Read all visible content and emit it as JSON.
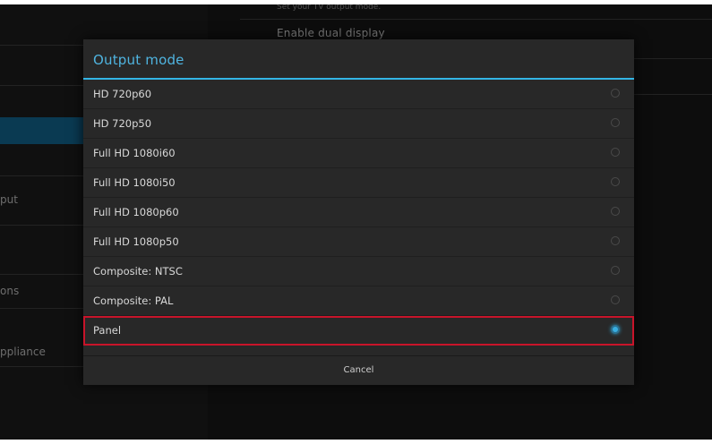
{
  "background": {
    "left_items": [
      {
        "label": ""
      },
      {
        "label": ""
      },
      {
        "label": ""
      },
      {
        "label": ""
      },
      {
        "label": "put"
      },
      {
        "label": ""
      },
      {
        "label": "ons"
      },
      {
        "label": "ppliance"
      }
    ],
    "right": {
      "summary": "Set your TV output mode.",
      "enable_dual_display": "Enable dual display"
    }
  },
  "dialog": {
    "title": "Output mode",
    "options": [
      {
        "label": "HD 720p60",
        "checked": false
      },
      {
        "label": "HD 720p50",
        "checked": false
      },
      {
        "label": "Full HD 1080i60",
        "checked": false
      },
      {
        "label": "Full HD 1080i50",
        "checked": false
      },
      {
        "label": "Full HD 1080p60",
        "checked": false
      },
      {
        "label": "Full HD 1080p50",
        "checked": false
      },
      {
        "label": "Composite: NTSC",
        "checked": false
      },
      {
        "label": "Composite: PAL",
        "checked": false
      },
      {
        "label": "Panel",
        "checked": true
      }
    ],
    "cancel_label": "Cancel"
  },
  "colors": {
    "accent": "#33b5e5",
    "highlight_outline": "#c8142a"
  }
}
